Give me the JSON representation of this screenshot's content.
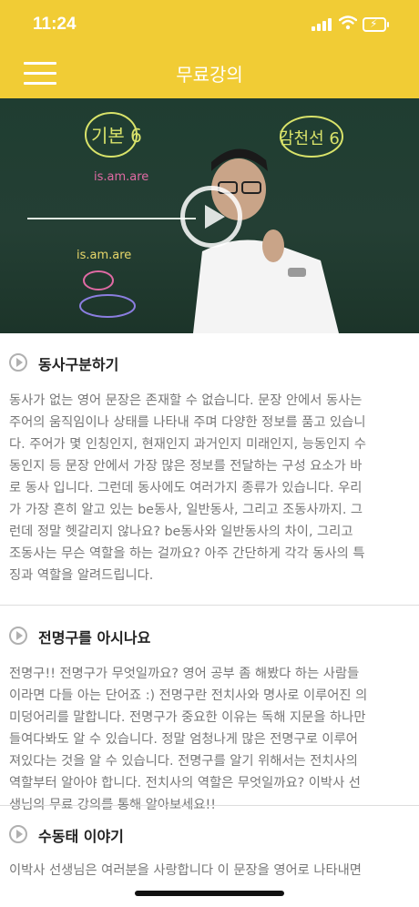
{
  "status_bar": {
    "time": "11:24"
  },
  "header": {
    "title": "무료강의"
  },
  "video": {
    "board_left": "기본 6",
    "board_right": "감천선 6",
    "board_chalk": "is.am.are"
  },
  "sections": [
    {
      "title": "동사구분하기",
      "body": "동사가 없는 영어 문장은 존재할 수 없습니다. 문장 안에서 동사는\n주어의 움직임이나 상태를 나타내 주며 다양한 정보를 품고 있습니\n다. 주어가 몇 인칭인지, 현재인지 과거인지 미래인지, 능동인지 수\n동인지 등 문장 안에서 가장 많은 정보를 전달하는 구성 요소가 바\n로 동사 입니다. 그런데 동사에도 여러가지 종류가 있습니다. 우리\n가 가장 흔히 알고 있는 be동사, 일반동사, 그리고 조동사까지. 그\n런데 정말 헷갈리지 않나요? be동사와 일반동사의 차이, 그리고\n조동사는 무슨 역할을 하는 걸까요? 아주 간단하게 각각 동사의 특\n징과 역할을 알려드립니다."
    },
    {
      "title": "전명구를 아시나요",
      "body": "전명구!! 전명구가 무엇일까요? 영어 공부 좀 해봤다 하는 사람들\n이라면 다들 아는 단어죠 :) 전명구란 전치사와 명사로 이루어진 의\n미덩어리를 말합니다. 전명구가 중요한 이유는 독해 지문을 하나만\n들여다봐도 알 수 있습니다. 정말 엄청나게 많은 전명구로 이루어\n져있다는 것을 알 수 있습니다. 전명구를 알기 위해서는 전치사의\n역할부터 알아야 합니다. 전치사의 역할은 무엇일까요? 이박사 선\n생님의 무료 강의를 통해 알아보세요!!"
    },
    {
      "title": "수동태 이야기",
      "body": "이박사 선생님은 여러분을 사랑합니다 이 문장을 영어로 나타내면"
    }
  ]
}
